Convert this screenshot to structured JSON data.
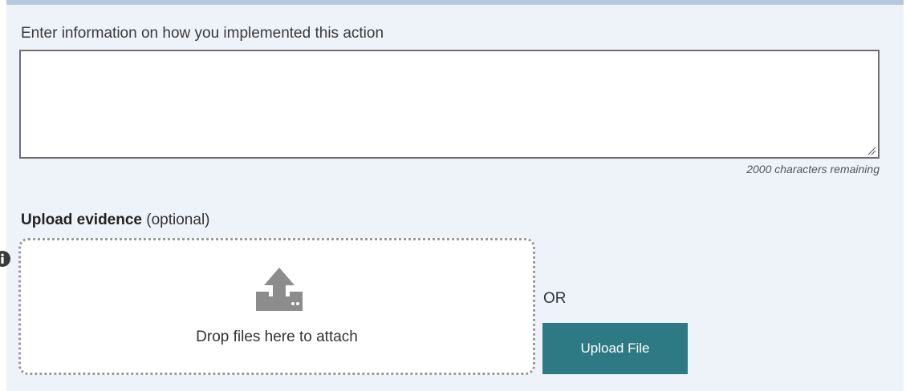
{
  "form": {
    "prompt": "Enter information on how you implemented this action",
    "textarea_value": "",
    "remaining": "2000 characters remaining"
  },
  "upload": {
    "label_bold": "Upload evidence",
    "label_optional": " (optional)",
    "drop_text": "Drop files here to attach",
    "or_text": "OR",
    "button_label": "Upload File",
    "info_icon": "info-circle",
    "upload_icon": "upload-tray"
  },
  "colors": {
    "panel_bg": "#eef2f9",
    "top_border": "#b8c8dc",
    "button_bg": "#2e7a84"
  }
}
